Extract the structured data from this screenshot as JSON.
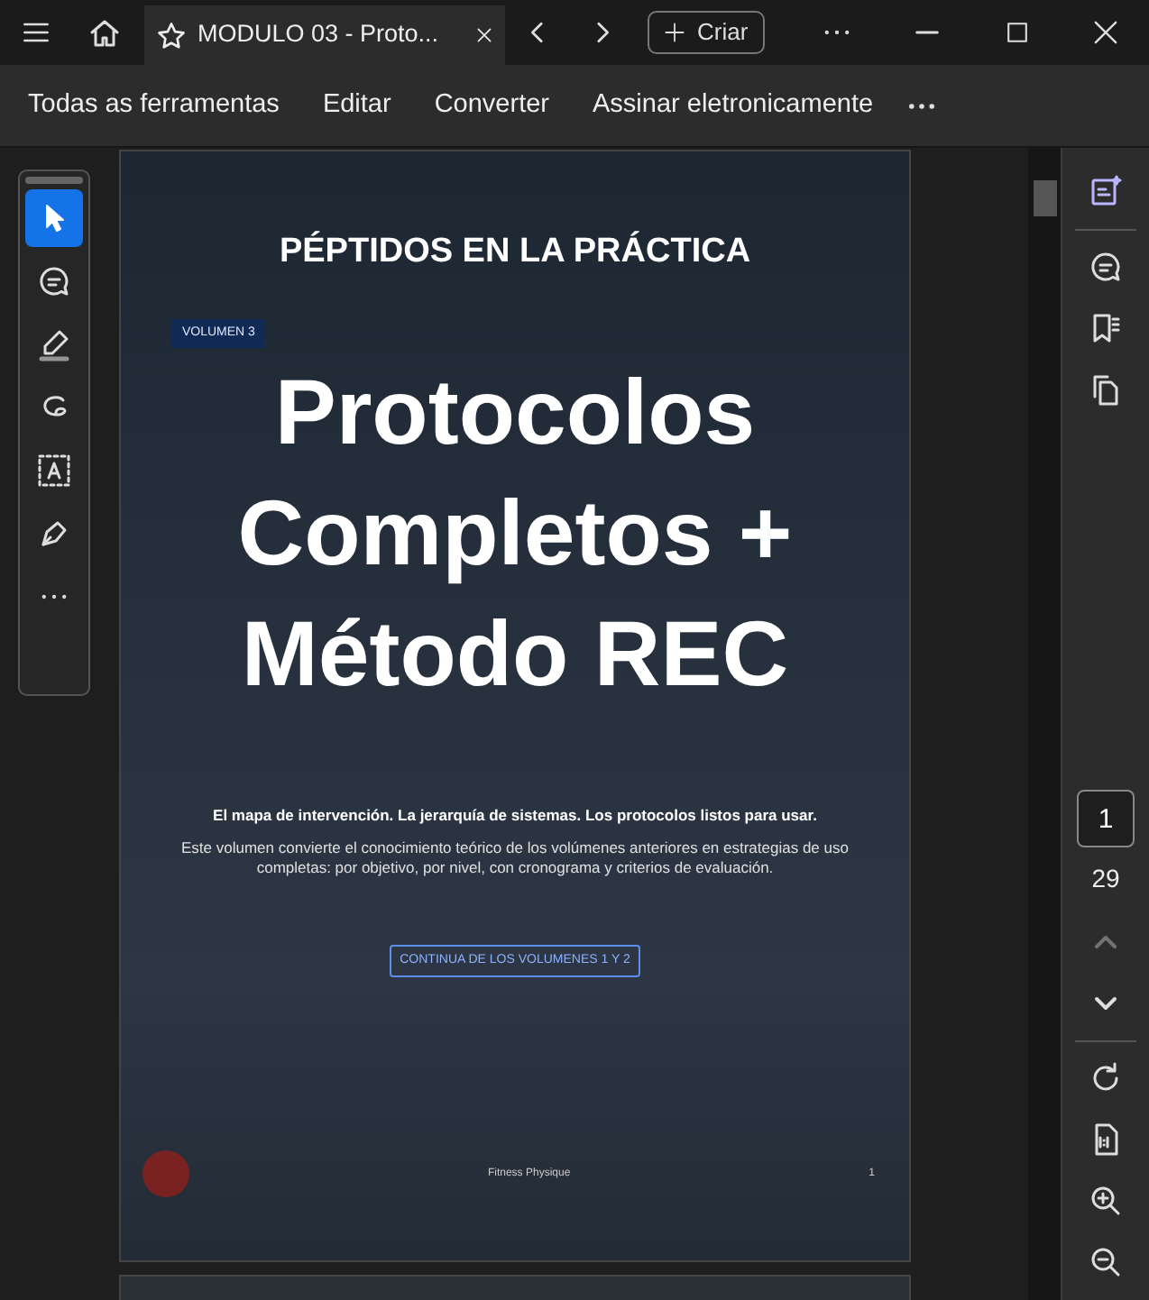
{
  "title_bar": {
    "tab": {
      "title": "MODULO 03 - Proto...",
      "selected": true
    },
    "create_button": "Criar"
  },
  "toolbar": {
    "items": [
      {
        "label": "Todas as ferramentas"
      },
      {
        "label": "Editar"
      },
      {
        "label": "Converter"
      },
      {
        "label": "Assinar eletronicamente"
      }
    ]
  },
  "tools": [
    {
      "kind": "select",
      "selected": true
    },
    {
      "kind": "comment",
      "selected": false
    },
    {
      "kind": "highlight",
      "selected": false
    },
    {
      "kind": "draw",
      "selected": false
    },
    {
      "kind": "text",
      "selected": false
    },
    {
      "kind": "sign",
      "selected": false
    }
  ],
  "page": {
    "heading": "PÉPTIDOS EN LA PRÁCTICA",
    "volume_tag": "VOLUMEN 3",
    "title_lines": [
      "Protocolos",
      "Completos +",
      "Método REC"
    ],
    "tagline": "El mapa de intervención. La jerarquía de sistemas. Los protocolos listos para usar.",
    "description": "Este volumen convierte el conocimiento teórico de los volúmenes anteriores en estrategias de uso completas: por objetivo, por nivel, con cronograma y criterios de evaluación.",
    "badge": "CONTINUA DE LOS VOLUMENES 1 Y 2",
    "footer": "Fitness Physique",
    "page_number": "1"
  },
  "page_nav": {
    "current": "1",
    "total": "29",
    "previous_disabled": true
  }
}
